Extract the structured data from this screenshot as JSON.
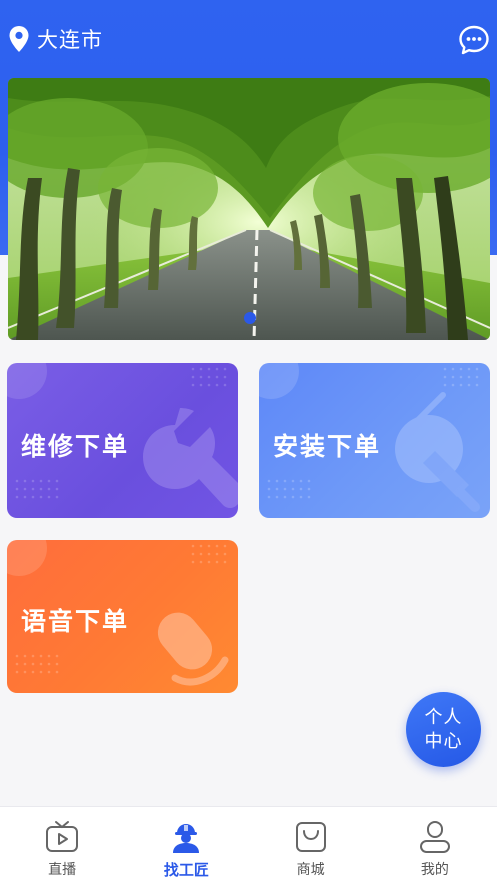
{
  "header": {
    "city": "大连市",
    "location_icon": "location-pin-icon",
    "message_icon": "chat-bubble-icon"
  },
  "banner": {
    "image": "tree-lined-road-photo",
    "active_slide": 1,
    "slide_count": 1
  },
  "services": [
    {
      "label": "维修下单",
      "icon": "wrench-icon",
      "color": "#6d52e0"
    },
    {
      "label": "安装下单",
      "icon": "plug-icon",
      "color": "#6a95f8"
    },
    {
      "label": "语音下单",
      "icon": "microphone-icon",
      "color": "#ff7a34"
    }
  ],
  "fab": {
    "line1": "个人",
    "line2": "中心"
  },
  "tabbar": {
    "items": [
      {
        "label": "直播",
        "icon": "tv-play-icon"
      },
      {
        "label": "找工匠",
        "icon": "worker-helmet-icon",
        "active": true
      },
      {
        "label": "商城",
        "icon": "shopping-bag-icon"
      },
      {
        "label": "我的",
        "icon": "user-profile-icon"
      }
    ]
  },
  "colors": {
    "primary": "#2d5fef",
    "active_tab": "#2b59e8",
    "inactive_tab": "#555555"
  }
}
